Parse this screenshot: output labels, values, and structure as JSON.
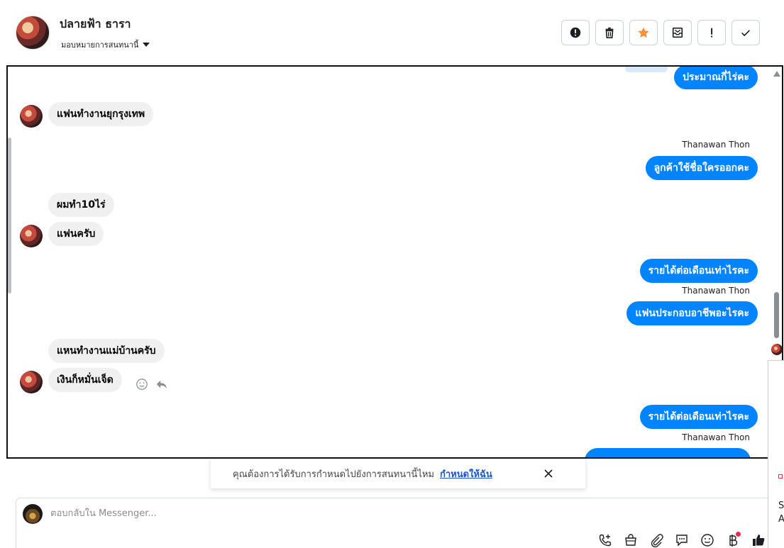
{
  "header": {
    "contact_name": "ปลายฟ้า ธารา",
    "assign_label": "มอบหมายการสนทนานี้"
  },
  "toolbar": {
    "icons": [
      "alert-circle-icon",
      "trash-icon",
      "star-icon",
      "inbox-icon",
      "exclamation-icon",
      "check-icon"
    ],
    "star_color": "#f7923b"
  },
  "messages": {
    "m1": "ประมาณกี่ไร่คะ",
    "m2": "แฟนทำงานยุกรุงเทพ",
    "m3_sender": "Thanawan Thon",
    "m3": "ลูกค้าใช้ชื่อใครออกคะ",
    "m4": "ผมทำ10ไร่",
    "m5": "แฟนครับ",
    "m6": "รายได้ต่อเดือนเท่าไรคะ",
    "m7_sender": "Thanawan Thon",
    "m7": "แฟนประกอบอาชีพอะไรคะ",
    "m8": "แหนทำงานแม่บ้านครับ",
    "m9": "เงินก็หมั่นเจ็ด",
    "m10": "รายได้ต่อเดือนเท่าไรคะ",
    "m11_sender": "Thanawan Thon"
  },
  "notice": {
    "text": "คุณต้องการได้รับการกำหนดไปยังการสนทนานี้ไหม",
    "link": "กำหนดให้ฉัน"
  },
  "composer": {
    "placeholder": "ตอบกลับใน Messenger..."
  },
  "side": {
    "letter1": "S",
    "letter2": "A"
  },
  "colors": {
    "outgoing_bubble": "#0084ff",
    "incoming_bubble": "#f0f0f0",
    "link": "#1a56c4",
    "notification_dot": "#f02849"
  }
}
